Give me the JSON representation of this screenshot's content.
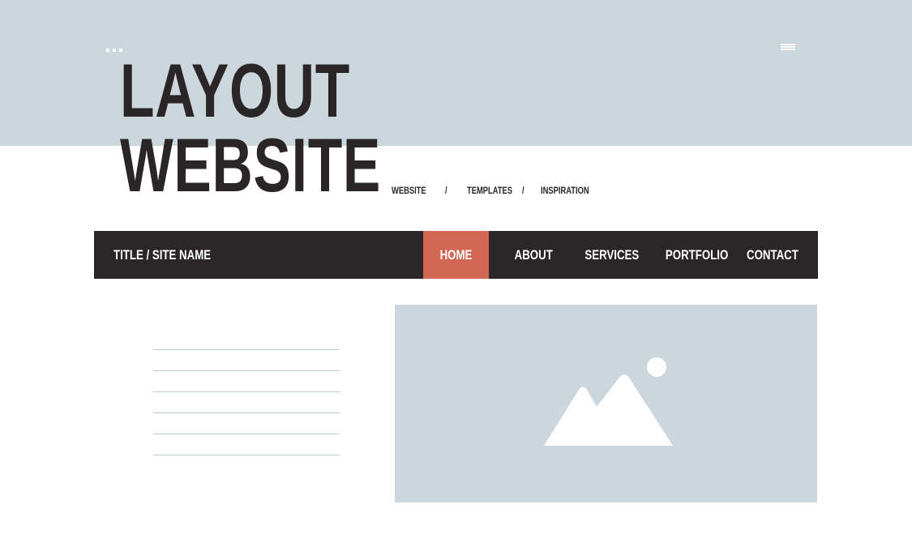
{
  "header": {
    "title_line1": "LAYOUT",
    "title_line2": "WEBSITE",
    "menu_icon": "hamburger-menu-icon",
    "dots_icon": "more-dots-icon"
  },
  "breadcrumb": {
    "items": [
      "WEBSITE",
      "TEMPLATES",
      "INSPIRATION"
    ],
    "separator": "/"
  },
  "navbar": {
    "site_name": "TITLE / SITE NAME",
    "items": [
      {
        "label": "HOME",
        "active": true
      },
      {
        "label": "ABOUT",
        "active": false
      },
      {
        "label": "SERVICES",
        "active": false
      },
      {
        "label": "PORTFOLIO",
        "active": false
      },
      {
        "label": "CONTACT",
        "active": false
      }
    ]
  },
  "content": {
    "text_lines_count": 6,
    "image_icon": "image-placeholder-icon"
  },
  "colors": {
    "band": "#cbd6dd",
    "navbar": "#2a2627",
    "accent": "#d36553",
    "text_dark": "#2a2627",
    "line": "#b8cbcf"
  }
}
